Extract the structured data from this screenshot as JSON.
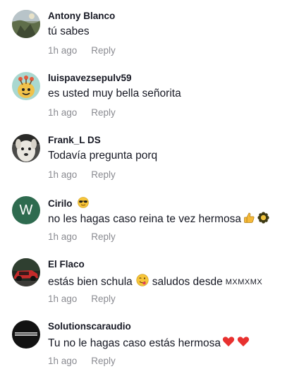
{
  "comments": [
    {
      "username": "Antony Blanco",
      "text": "tú sabes",
      "time": "1h ago",
      "reply_label": "Reply",
      "avatar_icon": "landscape-photo-avatar"
    },
    {
      "username": "luispavezsepulv59",
      "text": "es usted muy bella señorita",
      "time": "1h ago",
      "reply_label": "Reply",
      "avatar_icon": "cartoon-creature-avatar"
    },
    {
      "username": "Frank_L DS",
      "text": "Todavía pregunta porq",
      "time": "1h ago",
      "reply_label": "Reply",
      "avatar_icon": "dog-photo-avatar"
    },
    {
      "username": "Cirilo",
      "username_emoji": "sunglasses-face-emoji",
      "text": "no les hagas caso reina te vez hermosa",
      "text_emojis": [
        "thumbs-up-emoji",
        "flower-emoji"
      ],
      "time": "1h ago",
      "reply_label": "Reply",
      "avatar_letter": "W",
      "avatar_color": "#2e6b4f"
    },
    {
      "username": "El Flaco",
      "text": "estás bien schula",
      "text_emoji": "face-savoring-emoji",
      "text_after": "saludos desde",
      "text_small": "MXMXMX",
      "time": "1h ago",
      "reply_label": "Reply",
      "avatar_icon": "red-car-avatar"
    },
    {
      "username": "Solutionscaraudio",
      "text": "Tu no le hagas caso estás hermosa",
      "text_emojis": [
        "red-heart-emoji",
        "red-heart-emoji"
      ],
      "time": "1h ago",
      "reply_label": "Reply",
      "avatar_icon": "logo-avatar"
    }
  ]
}
